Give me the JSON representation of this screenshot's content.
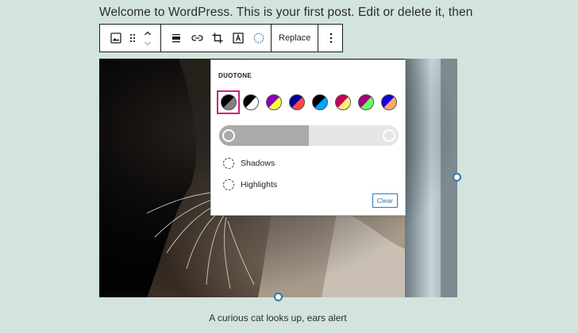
{
  "post": {
    "text": "Welcome to WordPress. This is your first post. Edit or delete it, then"
  },
  "toolbar": {
    "icons": [
      "image-icon",
      "drag-handle-icon",
      "move-up-icon",
      "move-down-icon",
      "align-icon",
      "link-icon",
      "crop-icon",
      "text-overlay-icon",
      "duotone-icon",
      "more-options-icon"
    ],
    "replace_label": "Replace"
  },
  "image": {
    "caption": "A curious cat looks up, ears alert"
  },
  "duotone": {
    "label": "DUOTONE",
    "swatches": [
      {
        "name": "dark-grayscale",
        "c1": "#000000",
        "c2": "#7f7f7f",
        "selected": true
      },
      {
        "name": "grayscale",
        "c1": "#000000",
        "c2": "#ffffff",
        "selected": false
      },
      {
        "name": "purple-yellow",
        "c1": "#8c00b7",
        "c2": "#fcff41",
        "selected": false
      },
      {
        "name": "blue-red",
        "c1": "#000097",
        "c2": "#ff4747",
        "selected": false
      },
      {
        "name": "midnight",
        "c1": "#000000",
        "c2": "#00a5ff",
        "selected": false
      },
      {
        "name": "magenta-yellow",
        "c1": "#c7005a",
        "c2": "#fff278",
        "selected": false
      },
      {
        "name": "purple-green",
        "c1": "#a60072",
        "c2": "#67ff66",
        "selected": false
      },
      {
        "name": "blue-orange",
        "c1": "#1900d8",
        "c2": "#ffa96b",
        "selected": false
      }
    ],
    "preview": {
      "shadow_color": "#aaaaaa",
      "highlight_color": "#e6e6e6",
      "split_fraction": 0.5
    },
    "shadows_label": "Shadows",
    "highlights_label": "Highlights",
    "clear_label": "Clear"
  },
  "colors": {
    "accent": "#3178a6",
    "selection": "#d0227a",
    "background": "#d2e4dd"
  }
}
